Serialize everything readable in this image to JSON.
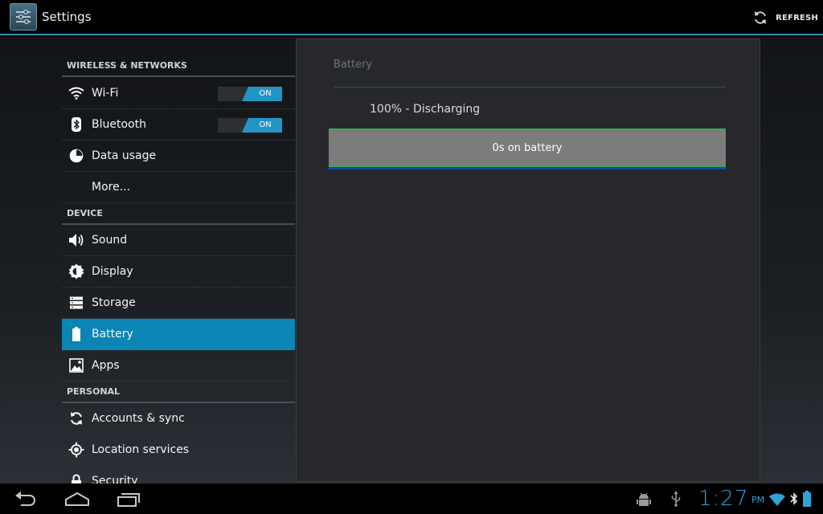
{
  "actionbar": {
    "title": "Settings",
    "refresh_label": "REFRESH"
  },
  "sections": {
    "wireless": "WIRELESS & NETWORKS",
    "device": "DEVICE",
    "personal": "PERSONAL"
  },
  "items": {
    "wifi": {
      "label": "Wi-Fi",
      "toggle": "ON",
      "icon": "wifi-icon"
    },
    "bluetooth": {
      "label": "Bluetooth",
      "toggle": "ON",
      "icon": "bluetooth-icon"
    },
    "data_usage": {
      "label": "Data usage",
      "icon": "pie-chart-icon"
    },
    "more": {
      "label": "More..."
    },
    "sound": {
      "label": "Sound",
      "icon": "speaker-icon"
    },
    "display": {
      "label": "Display",
      "icon": "brightness-icon"
    },
    "storage": {
      "label": "Storage",
      "icon": "storage-icon"
    },
    "battery": {
      "label": "Battery",
      "icon": "battery-icon"
    },
    "apps": {
      "label": "Apps",
      "icon": "apps-icon"
    },
    "accounts": {
      "label": "Accounts & sync",
      "icon": "sync-icon"
    },
    "location": {
      "label": "Location services",
      "icon": "location-icon"
    },
    "security": {
      "label": "Security",
      "icon": "lock-icon"
    }
  },
  "detail": {
    "title": "Battery",
    "status": "100% - Discharging",
    "graph_label": "0s on battery"
  },
  "statusbar": {
    "time": "1:27",
    "ampm": "PM"
  },
  "colors": {
    "accent": "#0b85b3",
    "clock": "#2fa4d4",
    "graph_green": "#2fb24b",
    "graph_blue": "#1e3fb5"
  }
}
